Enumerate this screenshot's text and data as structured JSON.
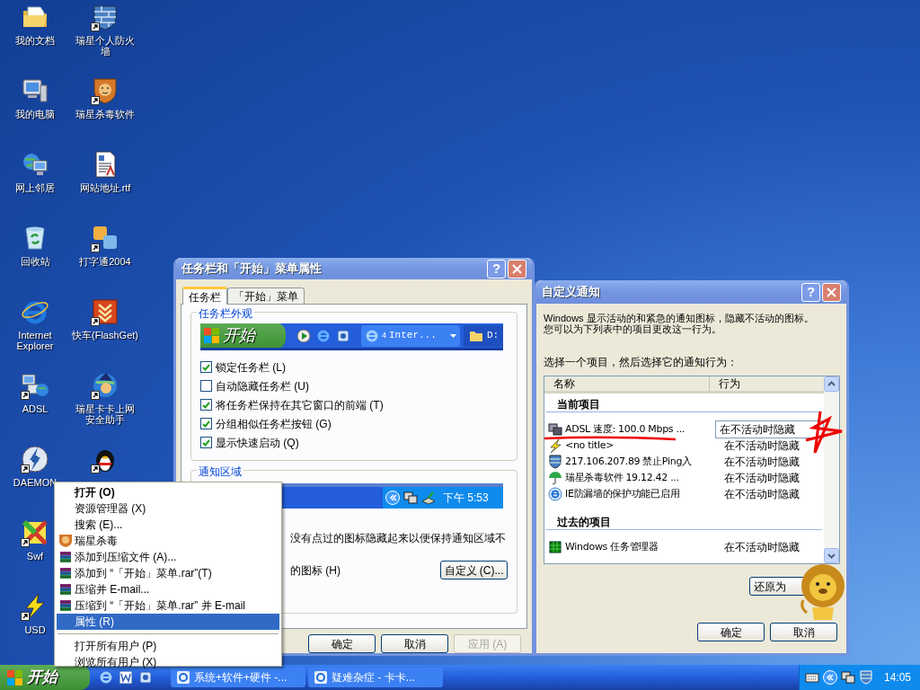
{
  "desktop_icons": [
    {
      "label": "我的文档",
      "kind": "folder",
      "shortcut": false
    },
    {
      "label": "我的电脑",
      "kind": "computer",
      "shortcut": false
    },
    {
      "label": "网上邻居",
      "kind": "network",
      "shortcut": false
    },
    {
      "label": "回收站",
      "kind": "recycle",
      "shortcut": false
    },
    {
      "label": "Internet Explorer",
      "kind": "ie",
      "shortcut": false
    },
    {
      "label": "ADSL",
      "kind": "adsl",
      "shortcut": true
    },
    {
      "label": "DAEMON",
      "kind": "daemon",
      "shortcut": true
    },
    {
      "label": "Swf",
      "kind": "swf",
      "shortcut": true
    },
    {
      "label": "USD",
      "kind": "usd",
      "shortcut": true
    },
    {
      "label": "瑞星个人防火墙",
      "kind": "firewall",
      "shortcut": true
    },
    {
      "label": "瑞星杀毒软件",
      "kind": "lion",
      "shortcut": true
    },
    {
      "label": "网站地址.rtf",
      "kind": "document",
      "shortcut": false
    },
    {
      "label": "打字通2004",
      "kind": "ab",
      "shortcut": true
    },
    {
      "label": "快车(FlashGet)",
      "kind": "flashget",
      "shortcut": true
    },
    {
      "label": "瑞星卡卡上网安全助手",
      "kind": "kaka",
      "shortcut": true
    },
    {
      "kind": "qq",
      "shortcut": true
    }
  ],
  "taskbar_dialog": {
    "title": "任务栏和「开始」菜单属性",
    "help_button": "?",
    "tabs": [
      {
        "label": "任务栏",
        "selected": true
      },
      {
        "label": "「开始」菜单",
        "selected": false
      }
    ],
    "appearance_group": {
      "title": "任务栏外观",
      "preview": {
        "start_label": "开始",
        "task_count": "4",
        "task_label": "Inter...",
        "folder_label": "D:"
      },
      "checkboxes": [
        {
          "label": "锁定任务栏 (L)",
          "checked": true
        },
        {
          "label": "自动隐藏任务栏 (U)",
          "checked": false
        },
        {
          "label": "将任务栏保持在其它窗口的前端 (T)",
          "checked": true
        },
        {
          "label": "分组相似任务栏按钮 (G)",
          "checked": true
        },
        {
          "label": "显示快速启动 (Q)",
          "checked": true
        }
      ]
    },
    "notification_group": {
      "title": "通知区域",
      "preview_clock": "下午 5:53",
      "description": "没有点过的图标隐藏起来以便保持通知区域不",
      "hide_option": "的图标 (H)",
      "customize_button": "自定义 (C)..."
    },
    "buttons": [
      {
        "label": "确定",
        "disabled": false
      },
      {
        "label": "取消",
        "disabled": false
      },
      {
        "label": "应用 (A)",
        "disabled": true
      }
    ]
  },
  "notify_dialog": {
    "title": "自定义通知",
    "help_button": "?",
    "description_lines": [
      "Windows 显示活动的和紧急的通知图标，隐藏不活动的图标。",
      "您可以为下列表中的项目更改这一行为。"
    ],
    "prompt": "选择一个项目，然后选择它的通知行为：",
    "columns": [
      "名称",
      "行为"
    ],
    "groups": [
      {
        "title": "当前项目",
        "items": [
          {
            "name": "ADSL 速度: 100.0 Mbps ...",
            "behavior": "在不活动时隐藏",
            "kind": "network",
            "selected": true
          },
          {
            "name": "<no title>",
            "behavior": "在不活动时隐藏",
            "kind": "lightning",
            "selected": false
          },
          {
            "name": "217.106.207.89 禁止Ping入",
            "behavior": "在不活动时隐藏",
            "kind": "firewall",
            "selected": false
          },
          {
            "name": "瑞星杀毒软件 19.12.42 ...",
            "behavior": "在不活动时隐藏",
            "kind": "umbrella",
            "selected": false
          },
          {
            "name": "IE防漏墙的保护功能已启用",
            "behavior": "在不活动时隐藏",
            "kind": "ie",
            "selected": false
          }
        ]
      },
      {
        "title": "过去的项目",
        "items": [
          {
            "name": "Windows 任务管理器",
            "behavior": "在不活动时隐藏",
            "kind": "taskmgr",
            "selected": false
          }
        ]
      }
    ],
    "restore_button": "还原为",
    "buttons": [
      "确定",
      "取消"
    ]
  },
  "context_menu": {
    "sections": [
      {
        "items": [
          {
            "label": "打开 (O)",
            "kind": "plain",
            "bold": true,
            "selected": false
          },
          {
            "label": "资源管理器 (X)",
            "kind": "plain",
            "bold": false,
            "selected": false
          },
          {
            "label": "搜索 (E)...",
            "kind": "plain",
            "bold": false,
            "selected": false
          },
          {
            "label": "瑞星杀毒",
            "kind": "antivirus",
            "bold": false,
            "selected": false
          },
          {
            "label": "添加到压缩文件 (A)...",
            "kind": "archive",
            "bold": false,
            "selected": false
          },
          {
            "label": "添加到 “「开始」菜单.rar”(T)",
            "kind": "archive",
            "bold": false,
            "selected": false
          },
          {
            "label": "压缩并 E-mail...",
            "kind": "archive",
            "bold": false,
            "selected": false
          },
          {
            "label": "压缩到 “「开始」菜单.rar” 并 E-mail",
            "kind": "archive",
            "bold": false,
            "selected": false
          },
          {
            "label": "属性 (R)",
            "kind": "plain",
            "bold": false,
            "selected": true
          }
        ]
      },
      {
        "items": [
          {
            "label": "打开所有用户 (P)",
            "kind": "plain",
            "bold": false,
            "selected": false
          },
          {
            "label": "浏览所有用户 (X)",
            "kind": "plain",
            "bold": false,
            "selected": false
          }
        ]
      }
    ]
  },
  "taskbar": {
    "start_label": "开始",
    "tasks": [
      {
        "label": "系统+软件+硬件 -...",
        "selected": false
      },
      {
        "label": "疑难杂症 - 卡卡...",
        "selected": false
      }
    ],
    "clock": "14:05"
  }
}
